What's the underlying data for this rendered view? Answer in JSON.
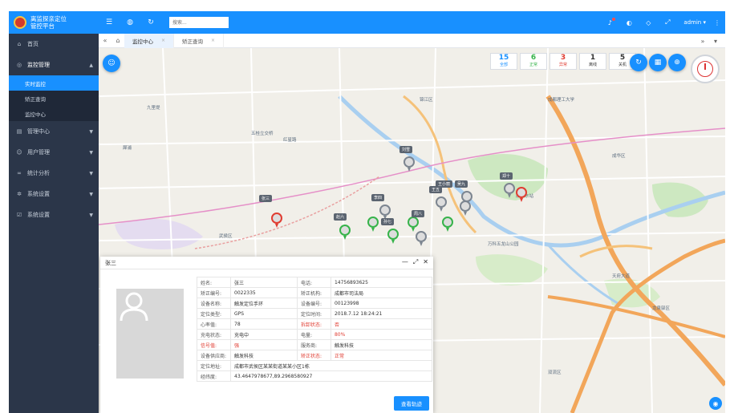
{
  "app": {
    "title_line1": "离监探亲定位",
    "title_line2": "管控平台"
  },
  "sidebar": {
    "items": [
      {
        "label": "首页",
        "icon": "home-icon"
      },
      {
        "label": "监控管理",
        "icon": "monitor-icon"
      },
      {
        "label": "管理中心",
        "icon": "manage-icon"
      },
      {
        "label": "用户管理",
        "icon": "user-icon"
      },
      {
        "label": "统计分析",
        "icon": "chart-icon"
      },
      {
        "label": "系统设置",
        "icon": "settings-icon"
      },
      {
        "label": "系统设置",
        "icon": "settings-icon"
      }
    ],
    "submenu": [
      "实时监控",
      "矫正查询",
      "监控中心"
    ]
  },
  "topbar": {
    "search_placeholder": "搜索...",
    "user": "admin"
  },
  "tabs": [
    "监控中心",
    "矫正查询"
  ],
  "stats": [
    {
      "value": "15",
      "label": "全部",
      "color": "#1890ff"
    },
    {
      "value": "6",
      "label": "正常",
      "color": "#36b34a"
    },
    {
      "value": "3",
      "label": "异常",
      "color": "#e03c31"
    },
    {
      "value": "1",
      "label": "离线",
      "color": "#222222"
    },
    {
      "value": "5",
      "label": "关机",
      "color": "#222222"
    }
  ],
  "map_labels": [
    "五桂立交桥",
    "成都东站",
    "红星路",
    "犀浦",
    "九里堤",
    "成都理工大学",
    "万科五龙山公园",
    "成华区",
    "锦江区",
    "武侯区",
    "双流区",
    "龙泉驿区",
    "天府大道"
  ],
  "marker_names": [
    "刘雪",
    "张三",
    "李四",
    "王五",
    "赵六",
    "孙七",
    "周八",
    "吴九",
    "郑十",
    "王小丽"
  ],
  "panel": {
    "title": "张三",
    "rows": [
      [
        "姓名:",
        "张三",
        "电话:",
        "14756893625"
      ],
      [
        "矫正编号:",
        "0022335",
        "矫正机构:",
        "成都市司法局"
      ],
      [
        "设备名称:",
        "触发定位手环",
        "设备编号:",
        "00123998"
      ],
      [
        "定位类型:",
        "GPS",
        "定位时间:",
        "2018.7.12 18:24:21"
      ],
      [
        "心率值:",
        "78",
        "拆卸状态:",
        "否"
      ],
      [
        "充电状态:",
        "充电中",
        "电量:",
        "80%"
      ],
      [
        "信号值:",
        "强",
        "服务商:",
        "触发科技"
      ],
      [
        "设备供应商:",
        "触发科技",
        "矫正状态:",
        "正常"
      ],
      [
        "定位地址:",
        "成都市武侯区某某街道某某小区1栋",
        "",
        ""
      ],
      [
        "经纬度:",
        "43.4647978677,89.2968580927",
        "",
        ""
      ]
    ],
    "track_button": "查看轨迹"
  }
}
